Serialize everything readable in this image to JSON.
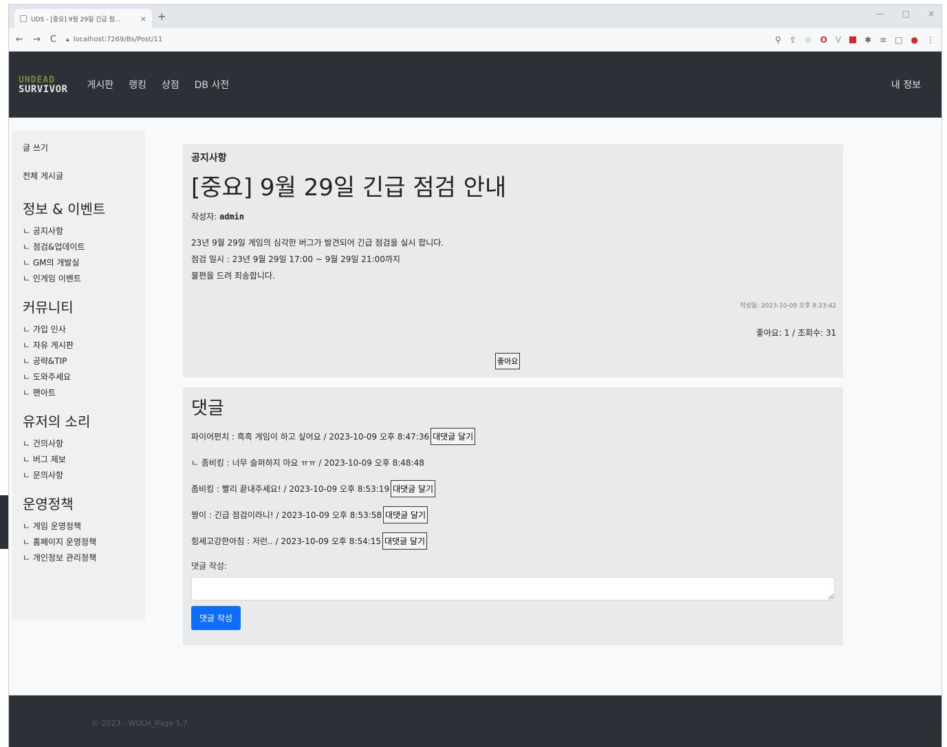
{
  "browser": {
    "tab_title": "UDS - [중요] 9월 29일 긴급 점...",
    "url": "localhost:7269/Bs/Post/11",
    "tab_close": "×",
    "new_tab": "+",
    "nav": {
      "back": "←",
      "forward": "→",
      "reload": "C"
    },
    "window_controls": {
      "minimize": "—",
      "maximize": "□",
      "close": "×"
    }
  },
  "site": {
    "logo_top": "UNDEAD",
    "logo_bottom": "SURVIVOR",
    "nav": [
      "게시판",
      "랭킹",
      "상점",
      "DB 사전"
    ],
    "my_info": "내 정보"
  },
  "sidebar": {
    "write": "글 쓰기",
    "all_posts": "전체 게시글",
    "groups": [
      {
        "title": "정보 & 이벤트",
        "items": [
          "ㄴ 공지사항",
          "ㄴ 점검&업데이트",
          "ㄴ GM의 개발실",
          "ㄴ 인게임 이벤트"
        ]
      },
      {
        "title": "커뮤니티",
        "items": [
          "ㄴ 가입 인사",
          "ㄴ 자유 게시판",
          "ㄴ 공략&TIP",
          "ㄴ 도와주세요",
          "ㄴ 팬아트"
        ]
      },
      {
        "title": "유저의 소리",
        "items": [
          "ㄴ 건의사항",
          "ㄴ 버그 제보",
          "ㄴ 문의사항"
        ]
      },
      {
        "title": "운영정책",
        "items": [
          "ㄴ 게임 운영정책",
          "ㄴ 홈페이지 운영정책",
          "ㄴ 개인정보 관리정책"
        ]
      }
    ]
  },
  "post": {
    "category": "공지사항",
    "title": "[중요] 9월 29일 긴급 점검 안내",
    "author_label": "작성자:",
    "author": "admin",
    "body": [
      "23년 9월 29일 게임의 심각한 버그가 발견되어 긴급 점검을 실시 합니다.",
      "점검 일시 : 23년 9월 29일 17:00 ~ 9월 29일 21:00까지",
      "불편을 드려 죄송합니다."
    ],
    "date": "작성일: 2023-10-09 오후 8:23:42",
    "stats": "좋아요: 1 / 조회수: 31",
    "like_button": "좋아요"
  },
  "comments": {
    "title": "댓글",
    "list": [
      {
        "text": "파이어펀치 : 흑흑 게임이 하고 싶어요 / 2023-10-09 오후 8:47:36",
        "reply": true
      },
      {
        "text": "ㄴ 좀비킹 : 너무 슬퍼하지 마요 ㅠㅠ / 2023-10-09 오후 8:48:48",
        "reply": false
      },
      {
        "text": "좀비킹 : 빨리 끝내주세요! / 2023-10-09 오후 8:53:19",
        "reply": true
      },
      {
        "text": "짱이 : 긴급 점검이라니! / 2023-10-09 오후 8:53:58",
        "reply": true
      },
      {
        "text": "힘세고강한아침 : 저런.. / 2023-10-09 오후 8:54:15",
        "reply": true
      }
    ],
    "reply_button": "대댓글 달기",
    "write_label": "댓글 작성:",
    "submit": "댓글 작성"
  },
  "footer": {
    "text": "© 2023 - WULH_Page 1.7"
  }
}
